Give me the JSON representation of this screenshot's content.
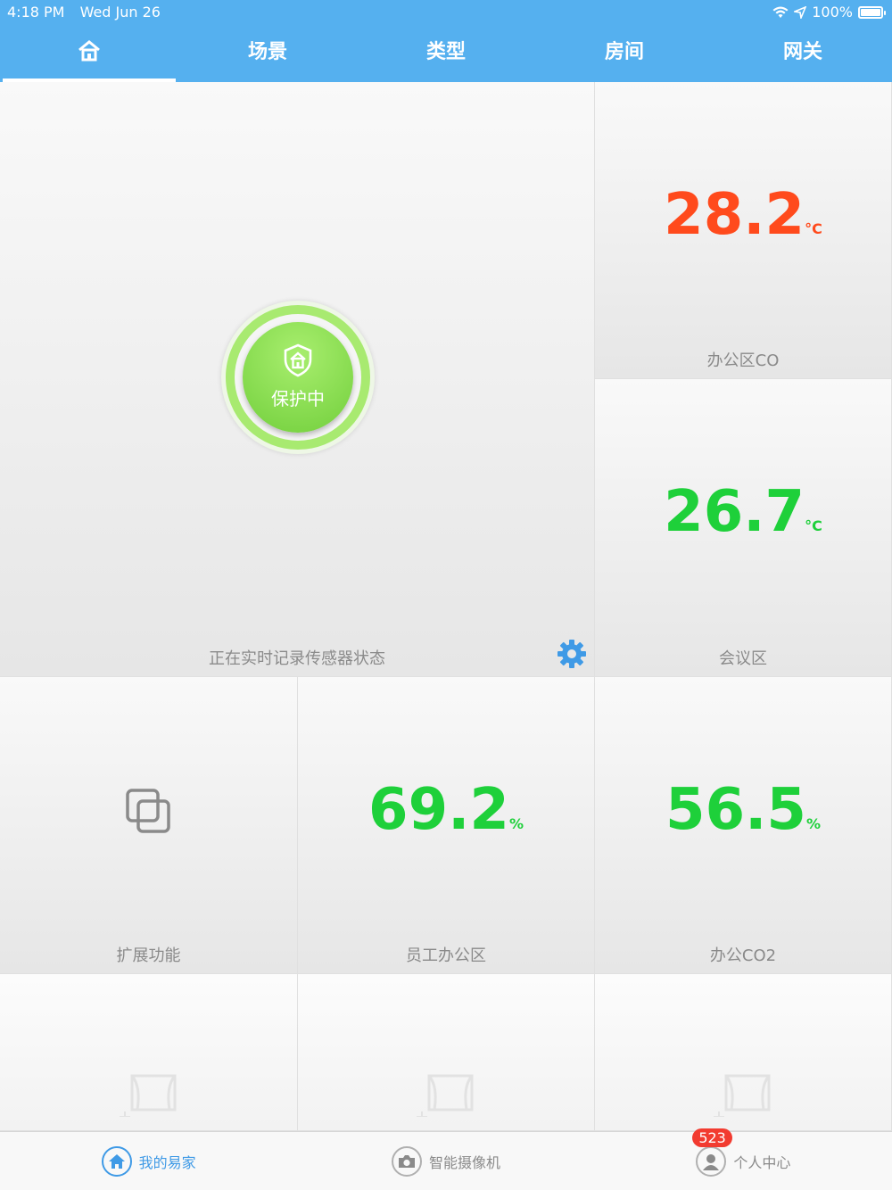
{
  "status_bar": {
    "time": "4:18 PM",
    "date": "Wed Jun 26",
    "battery": "100%"
  },
  "nav": {
    "tabs": [
      "场景",
      "类型",
      "房间",
      "网关"
    ]
  },
  "security": {
    "status_label": "保护中",
    "caption": "正在实时记录传感器状态"
  },
  "sensors": [
    {
      "value": "28.2",
      "unit": "°C",
      "name": "办公区CO",
      "color": "#ff4a1c"
    },
    {
      "value": "26.7",
      "unit": "°C",
      "name": "会议区",
      "color": "#1ed03a"
    },
    {
      "value": "69.2",
      "unit": "%",
      "name": "员工办公区",
      "color": "#1ed03a"
    },
    {
      "value": "56.5",
      "unit": "%",
      "name": "办公CO2",
      "color": "#1ed03a"
    }
  ],
  "extension": {
    "label": "扩展功能"
  },
  "tabbar": {
    "home": "我的易家",
    "camera": "智能摄像机",
    "profile": "个人中心",
    "badge": "523"
  }
}
